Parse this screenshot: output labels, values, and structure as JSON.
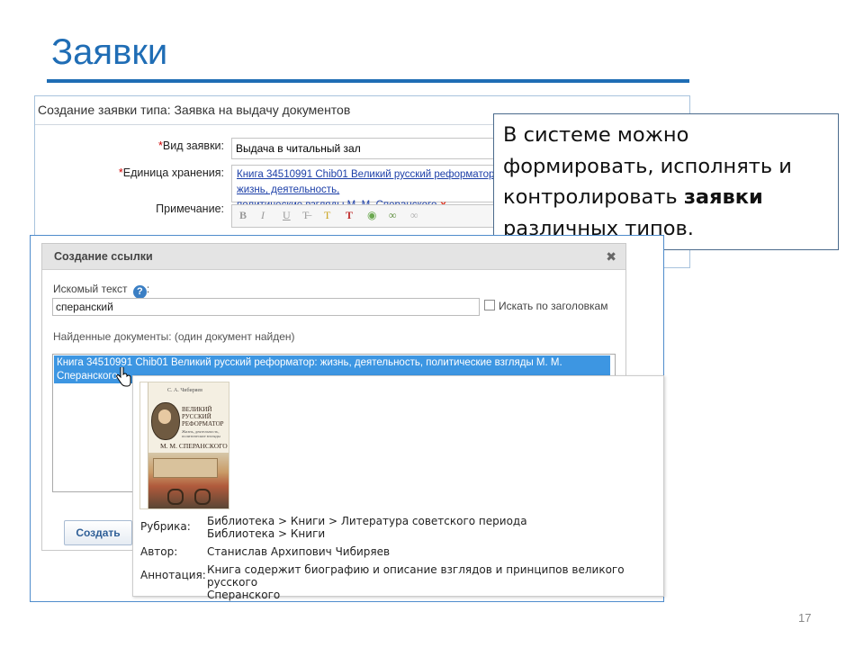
{
  "slide": {
    "title": "Заявки",
    "page_number": "17"
  },
  "request_form": {
    "header": "Создание заявки типа: Заявка на выдачу документов",
    "type_label": "Вид заявки:",
    "type_value": "Выдача в читальный зал",
    "unit_label": "Единица хранения:",
    "unit_value_line1": "Книга 34510991 Chib01 Великий русский реформатор: жизнь, деятельность,",
    "unit_value_line2": "политические взгляды М. М. Сперанского",
    "unit_remove": "x",
    "note_label": "Примечание:",
    "required_mark": "*",
    "toolbar": {
      "bold": "B",
      "italic": "I",
      "underline": "U"
    }
  },
  "callout": {
    "text_part1": "В системе можно формировать, исполнять и контролировать ",
    "text_bold": "заявки",
    "text_part2": " различных типов."
  },
  "link_dialog": {
    "title": "Создание ссылки",
    "close": "✖",
    "search_label": "Искомый текст",
    "search_suffix": ":",
    "help": "?",
    "search_value": "сперанский",
    "headings_checkbox_label": "Искать по заголовкам",
    "found_label": "Найденные документы: (один документ найден)",
    "selected_result_line1": "Книга 34510991 Chib01 Великий русский реформатор: жизнь, деятельность, политические взгляды М. М.",
    "selected_result_line2": "Сперанского",
    "create_button": "Создать"
  },
  "preview": {
    "cover": {
      "author": "С. А. Чибиряев",
      "title_line1": "ВЕЛИКИЙ",
      "title_line2": "РУССКИЙ",
      "title_line3": "РЕФОРМАТОР",
      "subtitle": "Жизнь, деятельность, политические взгляды",
      "name": "М. М. СПЕРАНСКОГО"
    },
    "rubric_label": "Рубрика:",
    "rubric_line1": "Библиотека > Книги > Литература советского периода",
    "rubric_line2": "Библиотека > Книги",
    "author_label": "Автор:",
    "author_value": "Станислав Архипович Чибиряев",
    "annotation_label": "Аннотация:",
    "annotation_line1": "Книга содержит биографию и описание взглядов и принципов великого русского",
    "annotation_line2": "Сперанского"
  },
  "colors": {
    "title_blue": "#1f6db5",
    "selection_blue": "#3d96e2",
    "required_red": "#d00000"
  }
}
